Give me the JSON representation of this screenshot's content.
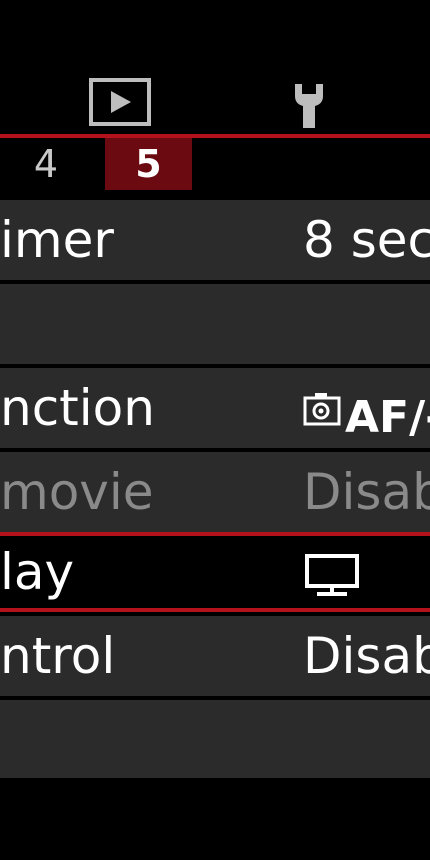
{
  "top_tabs": {
    "playback_icon": "playback-icon",
    "setup_icon": "wrench-icon"
  },
  "sub_tabs": [
    {
      "label": "4",
      "selected": false
    },
    {
      "label": "5",
      "selected": true
    }
  ],
  "menu": {
    "rows": [
      {
        "label": "imer",
        "value": "8 sec"
      },
      {
        "label": "",
        "value": ""
      },
      {
        "label": "nction",
        "value_text": "AF/-"
      },
      {
        "label": " movie",
        "value": "Disab",
        "disabled": true
      },
      {
        "label": "lay",
        "value_icon": "monitor-icon",
        "selected": true
      },
      {
        "label": "ntrol",
        "value": "Disab"
      },
      {
        "label": "",
        "value": ""
      }
    ]
  },
  "colors": {
    "accent_red": "#b3121c",
    "tab_selected_bg": "#6b0a10",
    "row_bg": "#2b2b2b",
    "dim_text": "#8a8a8a"
  }
}
